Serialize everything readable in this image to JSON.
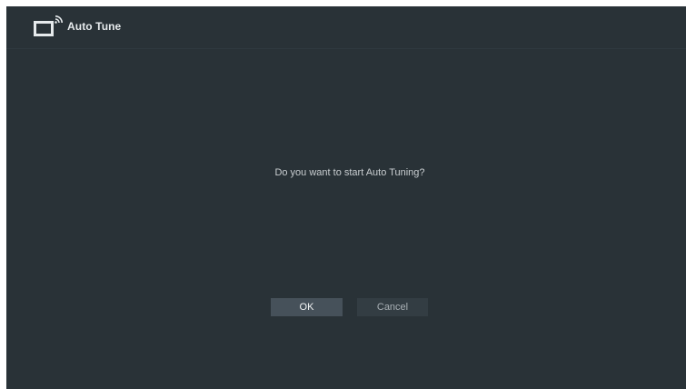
{
  "header": {
    "icon": "tv-signal-icon",
    "title": "Auto Tune"
  },
  "dialog": {
    "message": "Do you want to start Auto Tuning?",
    "buttons": {
      "ok_label": "OK",
      "cancel_label": "Cancel"
    }
  },
  "colors": {
    "background": "#293237",
    "focused_button": "#46515a",
    "button": "#333d43",
    "text": "#c9ced1"
  }
}
